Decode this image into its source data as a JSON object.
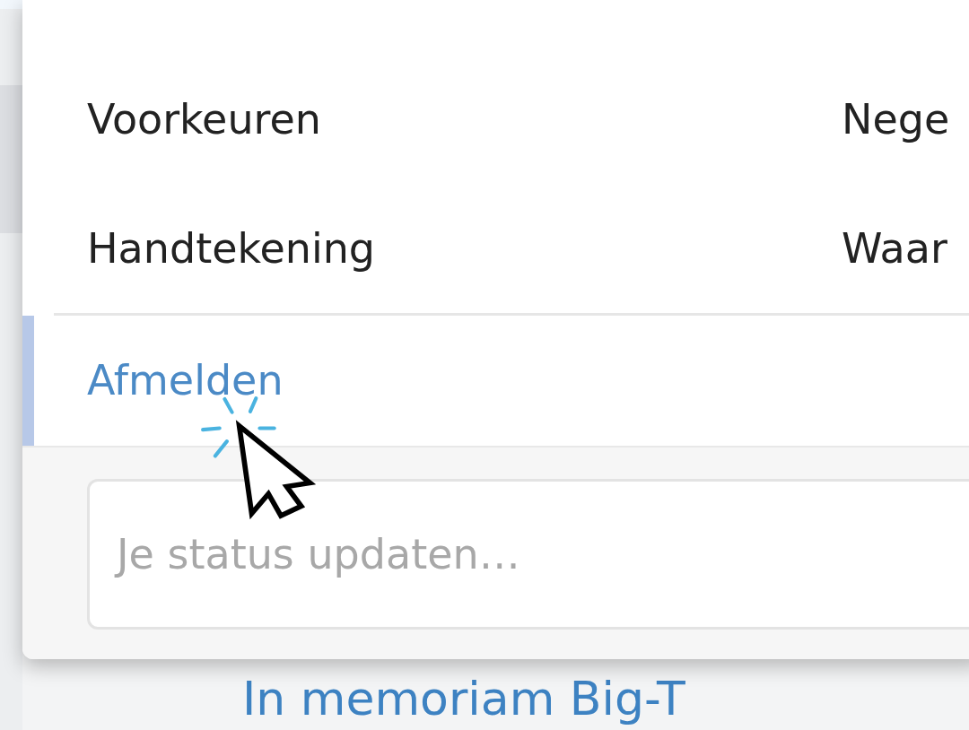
{
  "menu": {
    "items": [
      {
        "label": "Voorkeuren",
        "side_label": "Nege"
      },
      {
        "label": "Handtekening",
        "side_label": "Waar"
      }
    ],
    "logout": {
      "label": "Afmelden",
      "selected": true
    },
    "status": {
      "placeholder": "Je status updaten…"
    }
  },
  "page": {
    "heading": "In memoriam Big-T"
  }
}
